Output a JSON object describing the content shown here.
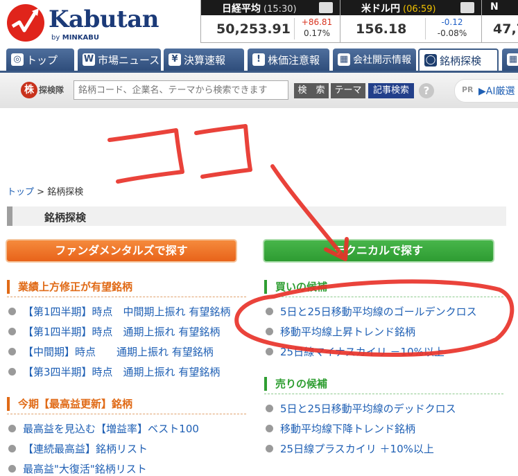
{
  "logo": {
    "name": "Kabutan",
    "sub_prefix": "by",
    "sub_brand": "MINKABU"
  },
  "tickers": [
    {
      "name": "日経平均",
      "time": "(15:30)",
      "price": "50,253.91",
      "change": "+86.81",
      "pct": "0.17%",
      "direction": "up",
      "time_color": "#dddddd"
    },
    {
      "name": "米ドル円",
      "time": "(06:59)",
      "price": "156.18",
      "change": "-0.12",
      "pct": "-0.08%",
      "direction": "down",
      "time_color": "#f2c200"
    },
    {
      "name": "N",
      "time": "",
      "price": "47,7",
      "change": "",
      "pct": "",
      "direction": "up",
      "time_color": "#dddddd"
    }
  ],
  "nav": {
    "tabs": [
      {
        "label": "トップ",
        "icon": "home-icon",
        "glyph": "◎"
      },
      {
        "label": "市場ニュース",
        "icon": "chart-icon",
        "glyph": "W"
      },
      {
        "label": "決算速報",
        "icon": "yen-icon",
        "glyph": "¥"
      },
      {
        "label": "株価注意報",
        "icon": "warning-icon",
        "glyph": "!"
      },
      {
        "label": "会社開示情報",
        "icon": "document-icon",
        "glyph": "▦"
      },
      {
        "label": "銘柄探検",
        "icon": "search-icon",
        "glyph": "◯"
      },
      {
        "label": "",
        "icon": "more-icon",
        "glyph": "▦"
      }
    ]
  },
  "search": {
    "badge": "株",
    "label": "探検隊",
    "placeholder": "銘柄コード、企業名、テーマから検索できます",
    "search_button": "検　索",
    "theme_button": "テーマ",
    "article_button": "記事検索",
    "help": "?",
    "ai_pr": "PR",
    "ai_label": "▶AI厳選"
  },
  "breadcrumb": {
    "home": "トップ",
    "separator": " > ",
    "current": "銘柄探検"
  },
  "page_title": "銘柄探検",
  "left": {
    "banner": "ファンダメンタルズで探す",
    "sections": [
      {
        "title": "業績上方修正が有望銘柄",
        "items": [
          "【第1四半期】時点　中間期上振れ 有望銘柄",
          "【第1四半期】時点　通期上振れ 有望銘柄",
          "【中間期】時点　　通期上振れ 有望銘柄",
          "【第3四半期】時点　通期上振れ 有望銘柄"
        ]
      },
      {
        "title": "今期【最高益更新】銘柄",
        "items": [
          "最高益を見込む【増益率】ベスト100",
          "【連続最高益】銘柄リスト",
          "最高益\"大復活\"銘柄リスト"
        ]
      }
    ]
  },
  "right": {
    "banner": "テクニカルで探す",
    "sections": [
      {
        "title": "買いの候補",
        "items": [
          "5日と25日移動平均線のゴールデンクロス",
          "移動平均線上昇トレンド銘柄",
          "25日線マイナスカイリ －10%以上"
        ]
      },
      {
        "title": "売りの候補",
        "items": [
          "5日と25日移動平均線のデッドクロス",
          "移動平均線下降トレンド銘柄",
          "25日線プラスカイリ ＋10%以上"
        ]
      }
    ]
  },
  "annotation": {
    "text": "ココ",
    "color": "#e8332a"
  }
}
